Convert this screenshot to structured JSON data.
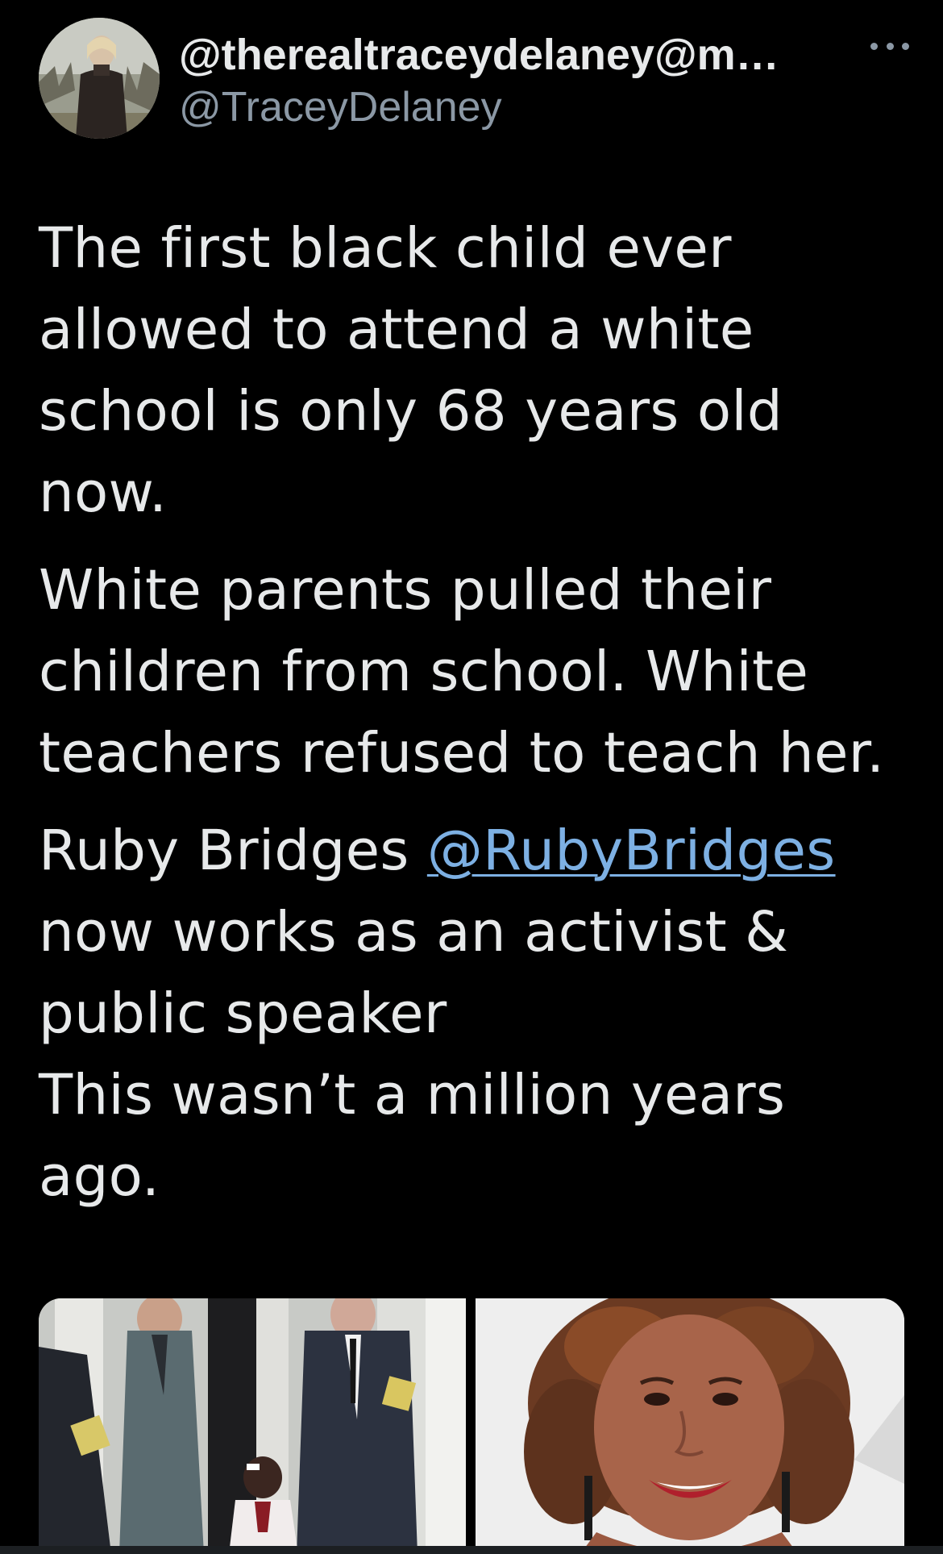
{
  "author": {
    "display_name": "@therealtraceydelaney@m…",
    "handle": "@TraceyDelaney",
    "avatar_icon": "profile-photo"
  },
  "more_menu": {
    "icon": "more-dots-icon"
  },
  "tweet": {
    "paragraph1": [
      "The first black child ever",
      "allowed to attend a white",
      "school is only 68 years old",
      "now."
    ],
    "paragraph2": [
      "White parents pulled their",
      "children from school. White",
      "teachers refused to teach her."
    ],
    "paragraph3": {
      "line1_prefix": "Ruby Bridges ",
      "mention": "@RubyBridges",
      "lines": [
        "now works as an activist &",
        "public speaker",
        "This wasn’t a million years",
        "ago."
      ]
    },
    "link_color": "#7db0e3"
  },
  "media": {
    "images": [
      {
        "name": "historical-escort-photo"
      },
      {
        "name": "portrait-photo"
      }
    ]
  },
  "colors": {
    "background": "#000000",
    "text": "#e7e9ea",
    "secondary": "#8b98a5"
  }
}
